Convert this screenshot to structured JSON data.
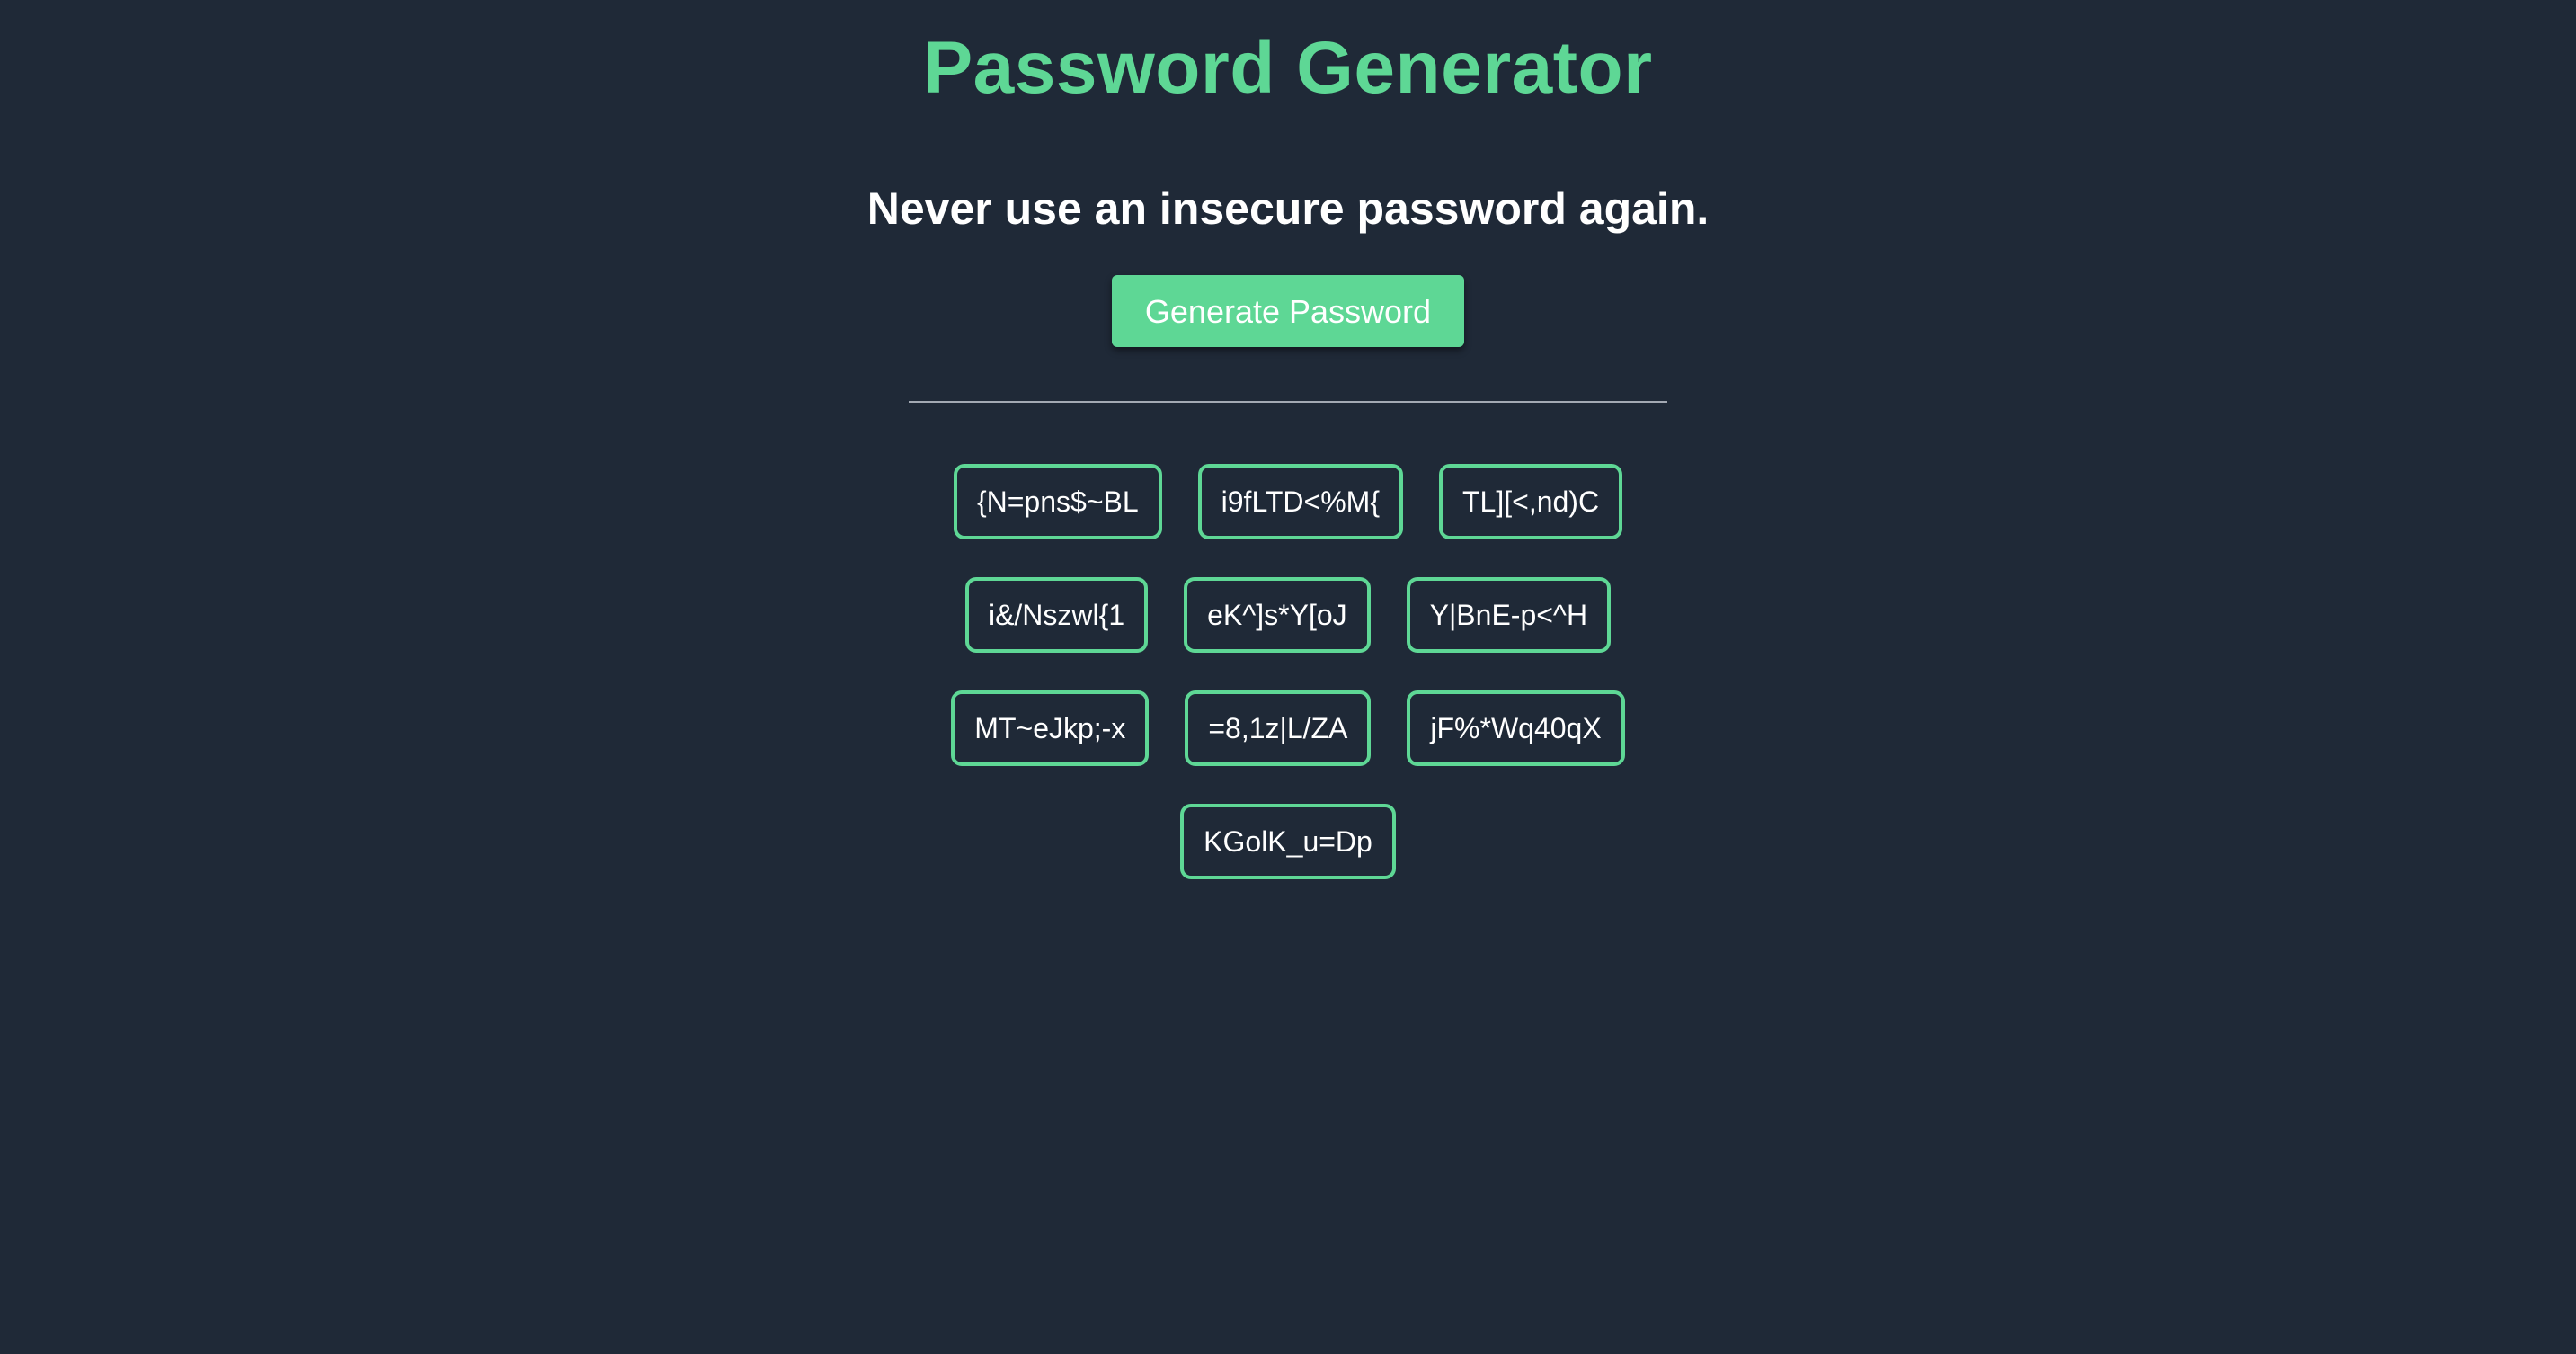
{
  "header": {
    "title": "Password Generator",
    "tagline": "Never use an insecure password again."
  },
  "actions": {
    "generate_label": "Generate Password"
  },
  "passwords": [
    "{N=pns$~BL",
    "i9fLTD<%M{",
    "TL][<,nd)C",
    "i&/Nszwl{1",
    "eK^]s*Y[oJ",
    "Y|BnE-p<^H",
    "MT~eJkp;-x",
    "=8,1z|L/ZA",
    "jF%*Wq40qX",
    "KGolK_u=Dp"
  ],
  "colors": {
    "background": "#1f2937",
    "accent": "#5ed795",
    "text": "#ffffff",
    "divider": "#a3a9b3"
  }
}
